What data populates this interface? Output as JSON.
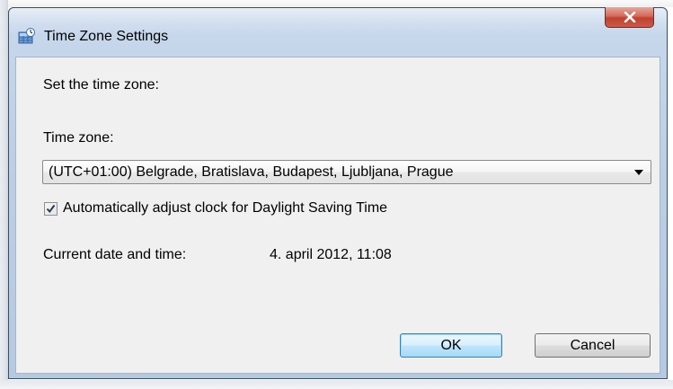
{
  "window": {
    "title": "Time Zone Settings",
    "close_glyph": "X"
  },
  "content": {
    "heading": "Set the time zone:",
    "time_zone_label": "Time zone:",
    "time_zone_selected": "(UTC+01:00) Belgrade, Bratislava, Budapest, Ljubljana, Prague",
    "dst_checkbox_label": "Automatically adjust clock for Daylight Saving Time",
    "dst_checked": true,
    "current_label": "Current date and time:",
    "current_value": "4. april 2012, 11:08"
  },
  "buttons": {
    "ok": "OK",
    "cancel": "Cancel"
  },
  "icons": {
    "title": "time-zone-globe-icon",
    "close": "close-icon",
    "dropdown": "chevron-down-icon",
    "check": "check-icon"
  },
  "colors": {
    "frame": "#bccfe5",
    "client_bg": "#f0f0f0",
    "close_red": "#c0402e",
    "default_button_border": "#3c7fb1"
  }
}
